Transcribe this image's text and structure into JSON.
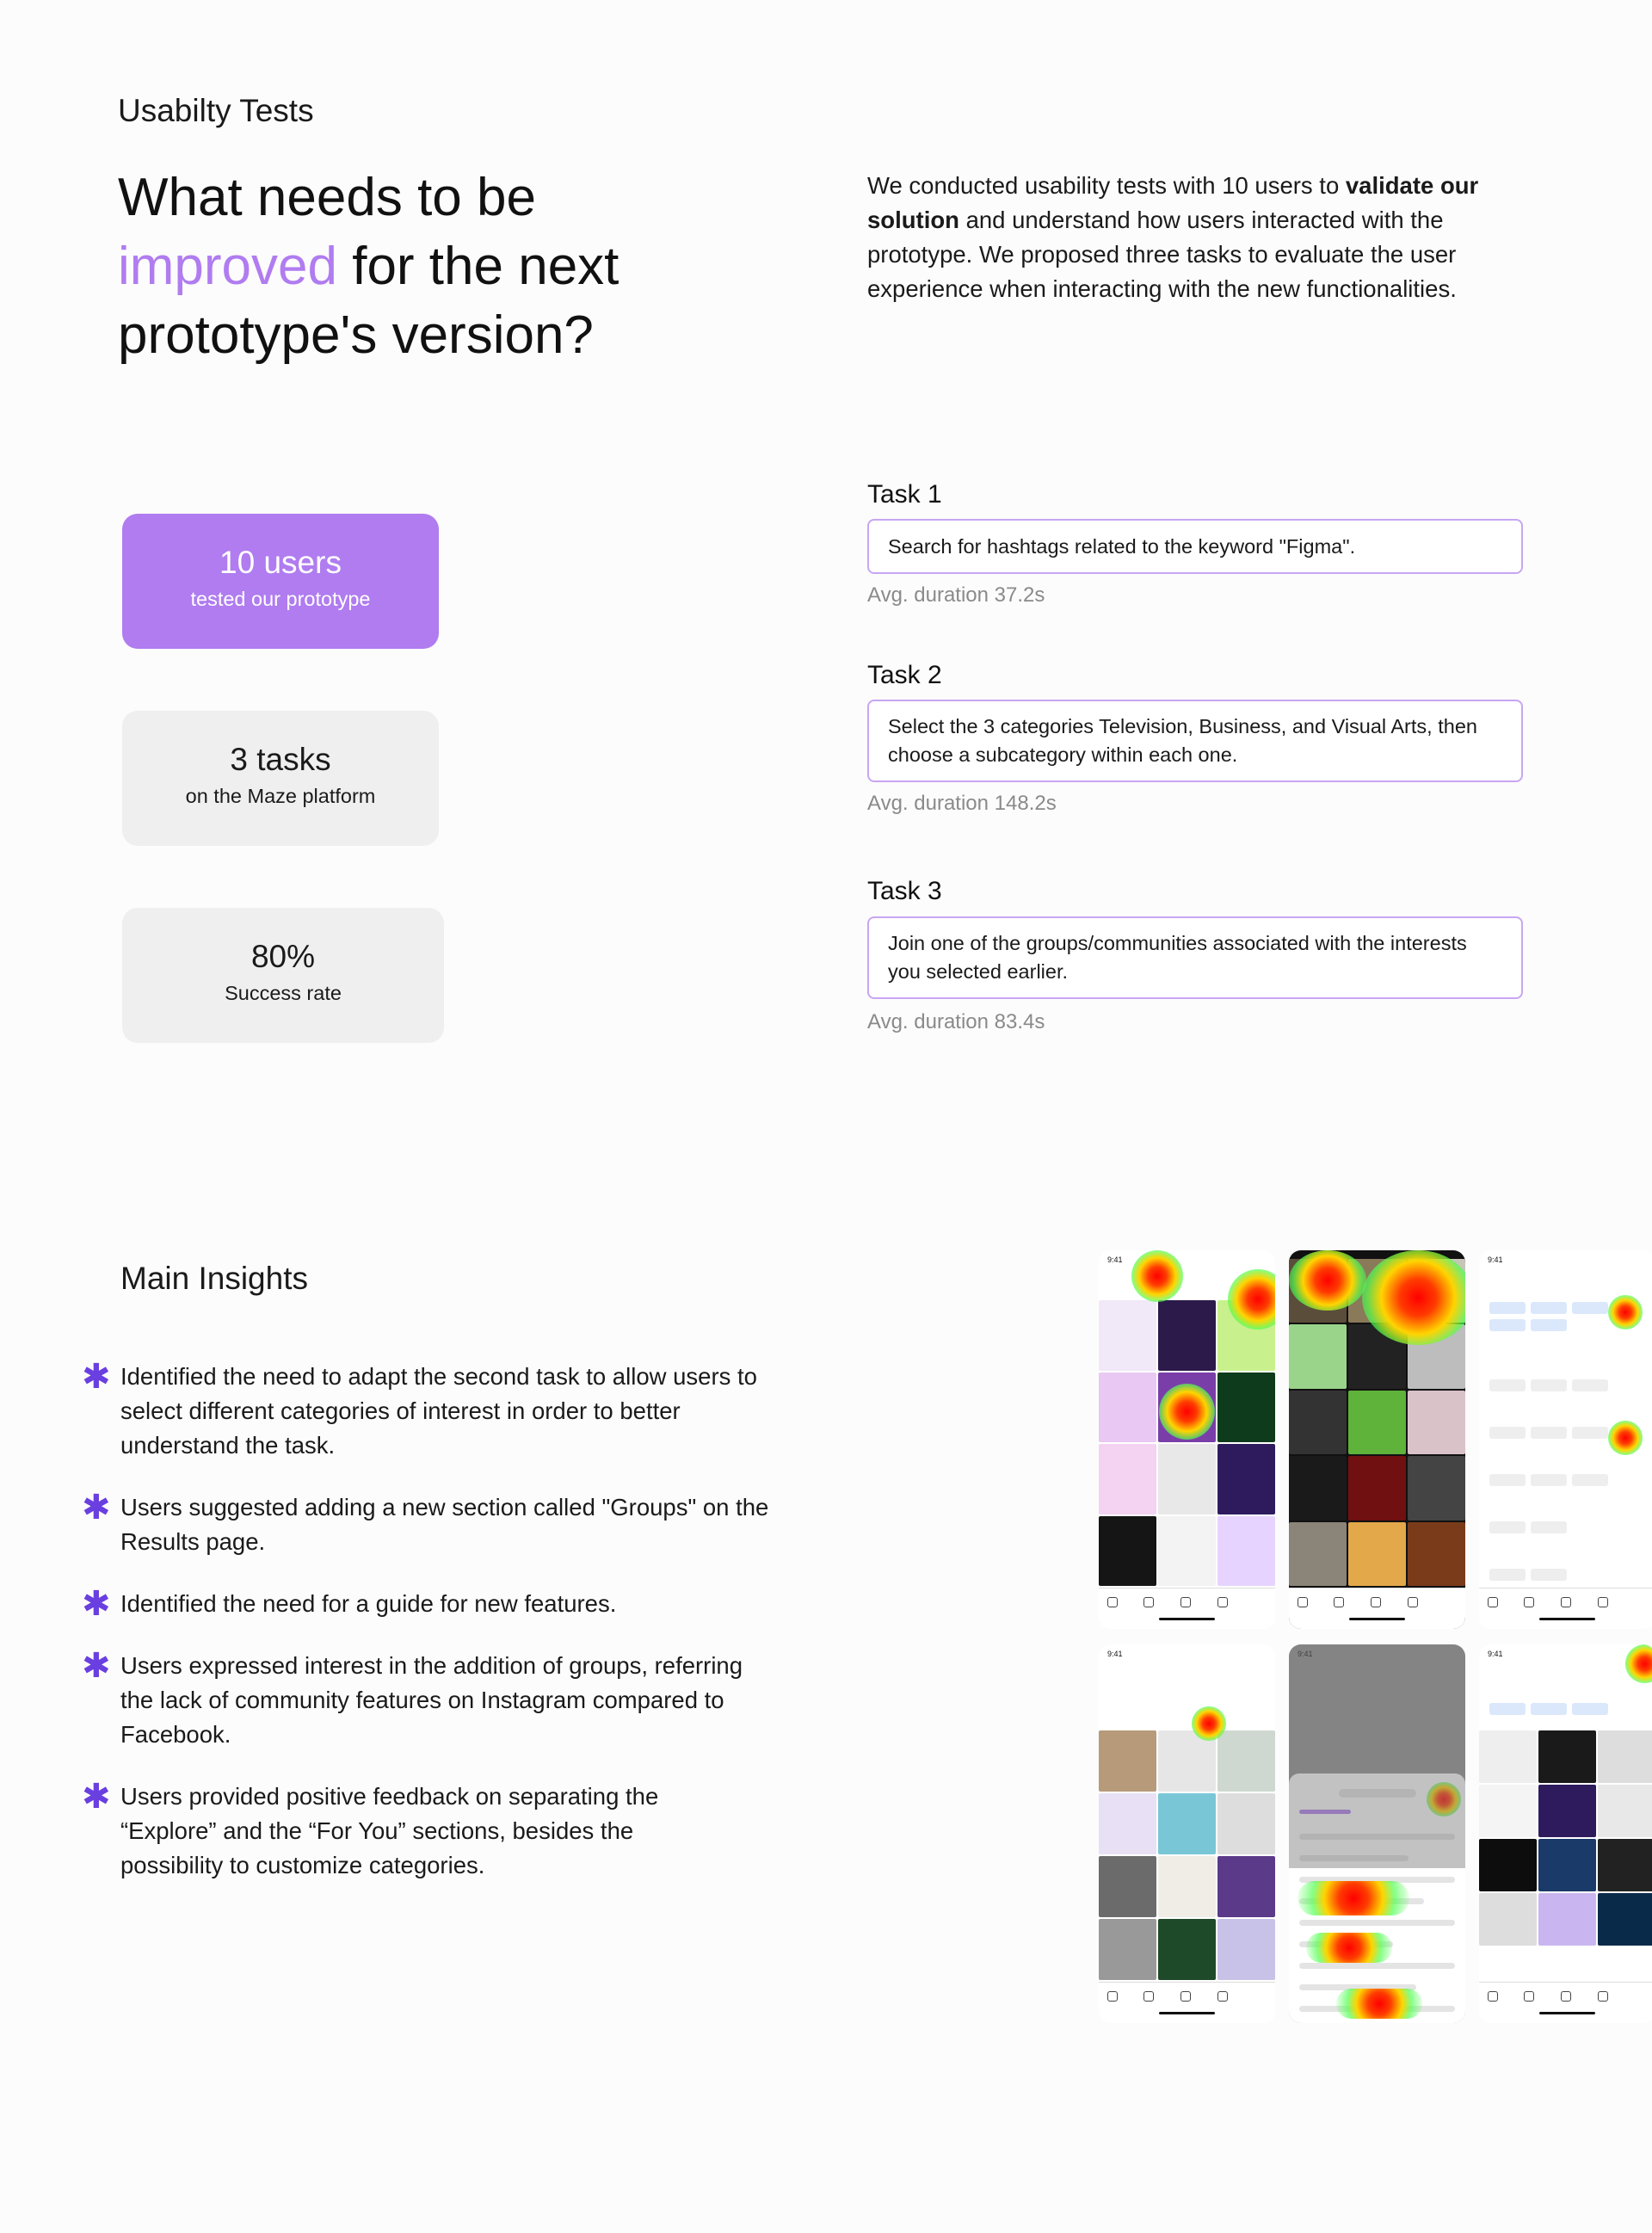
{
  "header": {
    "section_label": "Usabilty Tests",
    "headline_pre": "What needs to be",
    "headline_accent": "improved",
    "headline_post": " for the next prototype's version?",
    "intro_1": "We conducted usability tests with 10 users to ",
    "intro_bold": "validate our solution",
    "intro_2": " and understand how users interacted with the prototype. We proposed three tasks to evaluate the user experience when interacting with the new functionalities."
  },
  "stats": [
    {
      "value": "10 users",
      "label": "tested our prototype"
    },
    {
      "value": "3 tasks",
      "label": "on the Maze platform"
    },
    {
      "value": "80%",
      "label": "Success rate"
    }
  ],
  "tasks": [
    {
      "title": "Task 1",
      "description": "Search for hashtags related to the keyword \"Figma\".",
      "duration": "Avg. duration 37.2s"
    },
    {
      "title": "Task 2",
      "description": "Select the 3 categories Television, Business, and Visual Arts, then choose a subcategory within each one.",
      "duration": "Avg. duration 148.2s"
    },
    {
      "title": "Task 3",
      "description": "Join one of the groups/communities associated with the interests you selected earlier.",
      "duration": "Avg. duration 83.4s"
    }
  ],
  "insights": {
    "title": "Main Insights",
    "bullet_icon": "asterisk-icon",
    "items": [
      "Identified the need to adapt the second task to allow users to select different categories of interest in order to better understand the task.",
      "Users suggested adding a new section called \"Groups\" on the Results page.",
      "Identified the need for a guide for new features.",
      "Users expressed interest in the addition of groups, referring the lack of community features on Instagram compared to Facebook.",
      "Users provided positive feedback on separating the “Explore” and the “For You” sections, besides the possibility to customize categories."
    ]
  },
  "heatmaps": {
    "status_time": "9:41",
    "screens": [
      "search-results",
      "explore-grid",
      "filter",
      "for-you",
      "my-interests",
      "figma-results"
    ]
  },
  "colors": {
    "accent": "#b07cf0",
    "bullet": "#6a3fe0",
    "card_bg": "#efefef",
    "task_border": "#c8a6f3"
  }
}
